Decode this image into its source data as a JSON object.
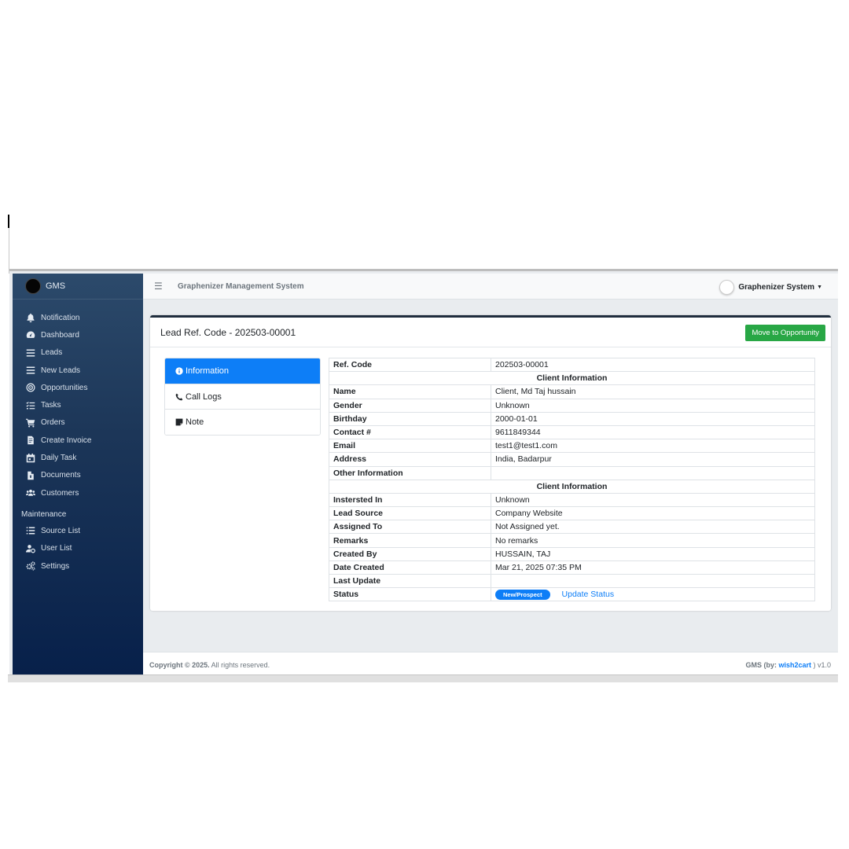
{
  "brand": {
    "name": "GMS"
  },
  "sidebar": {
    "items": [
      {
        "label": "Notification",
        "icon": "bell-icon"
      },
      {
        "label": "Dashboard",
        "icon": "speedometer-icon"
      },
      {
        "label": "Leads",
        "icon": "bars-icon"
      },
      {
        "label": "New Leads",
        "icon": "bars-icon"
      },
      {
        "label": "Opportunities",
        "icon": "target-icon"
      },
      {
        "label": "Tasks",
        "icon": "tasks-icon"
      },
      {
        "label": "Orders",
        "icon": "cart-icon"
      },
      {
        "label": "Create Invoice",
        "icon": "invoice-icon"
      },
      {
        "label": "Daily Task",
        "icon": "calendar-icon"
      },
      {
        "label": "Documents",
        "icon": "document-icon"
      },
      {
        "label": "Customers",
        "icon": "users-icon"
      }
    ],
    "section_header": "Maintenance",
    "maintenance_items": [
      {
        "label": "Source List",
        "icon": "list-icon"
      },
      {
        "label": "User List",
        "icon": "user-cog-icon"
      },
      {
        "label": "Settings",
        "icon": "gears-icon"
      }
    ]
  },
  "topbar": {
    "title": "Graphenizer Management System",
    "user": "Graphenizer System"
  },
  "card": {
    "title": "Lead Ref. Code - 202503-00001",
    "action_button": "Move to Opportunity"
  },
  "tabs": [
    {
      "label": "Information",
      "icon": "info-circle-icon"
    },
    {
      "label": "Call Logs",
      "icon": "phone-icon"
    },
    {
      "label": "Note",
      "icon": "sticky-note-icon"
    }
  ],
  "lead": {
    "ref_code_label": "Ref. Code",
    "ref_code": "202503-00001",
    "section1": "Client Information",
    "rows1": [
      {
        "k": "Name",
        "v": "Client, Md Taj hussain"
      },
      {
        "k": "Gender",
        "v": "Unknown"
      },
      {
        "k": "Birthday",
        "v": "2000-01-01"
      },
      {
        "k": "Contact #",
        "v": "9611849344"
      },
      {
        "k": "Email",
        "v": "test1@test1.com"
      },
      {
        "k": "Address",
        "v": "India, Badarpur"
      },
      {
        "k": "Other Information",
        "v": ""
      }
    ],
    "section2": "Client Information",
    "rows2": [
      {
        "k": "Instersted In",
        "v": "Unknown"
      },
      {
        "k": "Lead Source",
        "v": "Company Website"
      },
      {
        "k": "Assigned To",
        "v": "Not Assigned yet."
      },
      {
        "k": "Remarks",
        "v": "No remarks"
      },
      {
        "k": "Created By",
        "v": "HUSSAIN, TAJ"
      },
      {
        "k": "Date Created",
        "v": "Mar 21, 2025 07:35 PM"
      },
      {
        "k": "Last Update",
        "v": ""
      }
    ],
    "status_label": "Status",
    "status_badge": "New/Prospect",
    "update_status": "Update Status"
  },
  "footer": {
    "copyright_bold": "Copyright © 2025.",
    "copyright_rest": " All rights reserved.",
    "credit_prefix": "GMS (by: ",
    "credit_link": "wish2cart",
    "credit_suffix": " ) v1.0"
  },
  "colors": {
    "primary": "#0d7ef7",
    "success": "#28a745",
    "sidebar_dark": "#07204a"
  }
}
